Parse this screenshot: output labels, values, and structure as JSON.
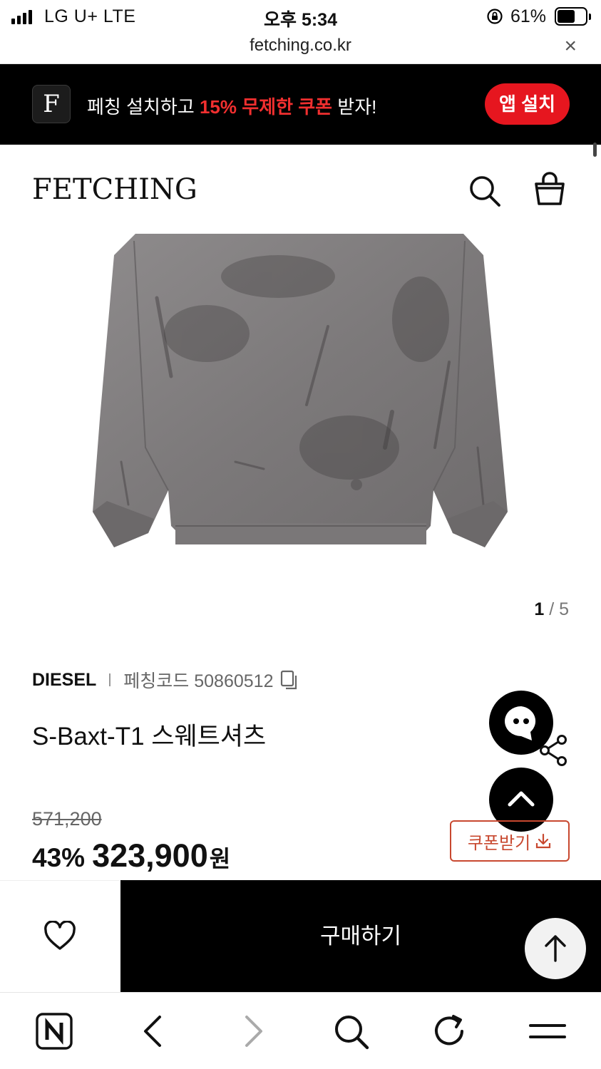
{
  "status_bar": {
    "carrier": "LG U+  LTE",
    "time": "오후 5:34",
    "battery": "61%"
  },
  "browser": {
    "url": "fetching.co.kr",
    "close_label": "×"
  },
  "app_banner": {
    "logo_letter": "F",
    "text_before": "페칭 설치하고 ",
    "text_highlight": "15% 무제한 쿠폰",
    "text_after": " 받자!",
    "install_label": "앱 설치",
    "accent_color": "#e6161f"
  },
  "header": {
    "brand": "FETCHING"
  },
  "gallery": {
    "current": "1",
    "separator": " / ",
    "total": "5"
  },
  "product": {
    "brand": "DIESEL",
    "code_label": "페칭코드 50860512",
    "name": "S-Baxt-T1 스웨트셔츠",
    "original_price": "571,200",
    "discount": "43%",
    "price": "323,900",
    "currency": "원",
    "coupon_label": "쿠폰받기"
  },
  "purchase_bar": {
    "buy_label": "구매하기"
  },
  "icons": [
    "lock-rotation-icon",
    "search-icon",
    "shopping-bag-icon",
    "copy-icon",
    "chat-icon",
    "share-icon",
    "chevron-up-icon",
    "download-icon",
    "heart-icon",
    "arrow-up-icon",
    "naver-icon",
    "back-icon",
    "forward-icon",
    "refresh-icon",
    "menu-icon"
  ]
}
